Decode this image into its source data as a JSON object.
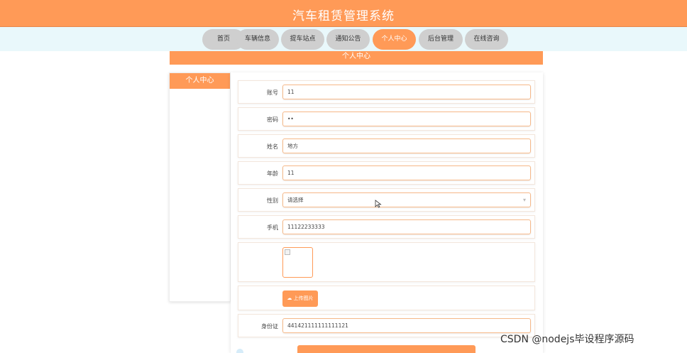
{
  "app": {
    "title": "汽车租赁管理系统"
  },
  "nav": {
    "items": [
      {
        "label": "首页"
      },
      {
        "label": "车辆信息"
      },
      {
        "label": "提车站点"
      },
      {
        "label": "通知公告"
      },
      {
        "label": "个人中心"
      },
      {
        "label": "后台管理"
      },
      {
        "label": "在线咨询"
      }
    ],
    "active_index": 4
  },
  "section": {
    "title": "个人中心"
  },
  "sidebar": {
    "title": "个人中心"
  },
  "form": {
    "account": {
      "label": "账号",
      "value": "11"
    },
    "password": {
      "label": "密码",
      "value": "••"
    },
    "name": {
      "label": "姓名",
      "value": "地方"
    },
    "age": {
      "label": "年龄",
      "value": "11"
    },
    "gender": {
      "label": "性别",
      "value": "请选择"
    },
    "phone": {
      "label": "手机",
      "value": "11122233333"
    },
    "upload": {
      "label": "上传图片"
    },
    "id_card": {
      "label": "身份证",
      "value": "441421111111111121"
    }
  },
  "watermark": {
    "text": "CSDN @nodejs毕设程序源码"
  },
  "colors": {
    "accent": "#ff9a57",
    "nav_background": "#e9f8fb",
    "nav_inactive": "#cfcfcf"
  }
}
